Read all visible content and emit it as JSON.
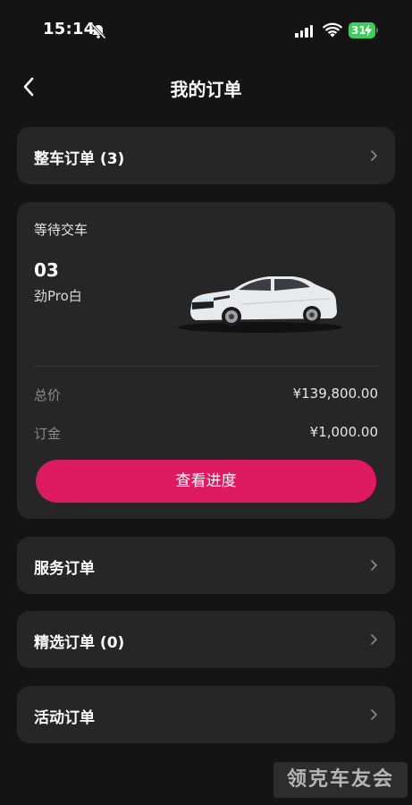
{
  "status_bar": {
    "time": "15:14",
    "battery": "31"
  },
  "nav": {
    "title": "我的订单"
  },
  "vehicle_orders": {
    "label": "整车订单 (3)"
  },
  "order_card": {
    "status": "等待交车",
    "order_number": "03",
    "model": "劲Pro白",
    "total_label": "总价",
    "total_value": "¥139,800.00",
    "deposit_label": "订金",
    "deposit_value": "¥1,000.00",
    "progress_button": "查看进度"
  },
  "service_orders": {
    "label": "服务订单"
  },
  "selected_orders": {
    "label": "精选订单 (0)"
  },
  "activity_orders": {
    "label": "活动订单"
  },
  "watermark": {
    "text": "领克车友会"
  },
  "colors": {
    "background": "#141414",
    "card": "#262626",
    "accent": "#de1a60",
    "battery": "#3ccf5c"
  }
}
